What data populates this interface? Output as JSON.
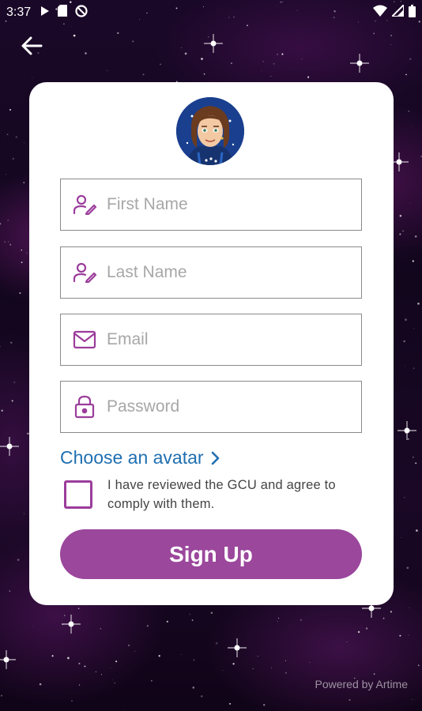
{
  "status_bar": {
    "time": "3:37",
    "icons_left": [
      "play-icon",
      "sd-card-icon",
      "do-not-disturb-icon"
    ],
    "icons_right": [
      "wifi-icon",
      "signal-icon",
      "battery-icon"
    ]
  },
  "header": {
    "back_icon": "arrow-left-icon"
  },
  "form": {
    "fields": [
      {
        "name": "first-name",
        "placeholder": "First Name",
        "value": "",
        "icon": "user-edit-icon"
      },
      {
        "name": "last-name",
        "placeholder": "Last Name",
        "value": "",
        "icon": "user-edit-icon"
      },
      {
        "name": "email",
        "placeholder": "Email",
        "value": "",
        "icon": "envelope-icon"
      },
      {
        "name": "password",
        "placeholder": "Password",
        "value": "",
        "icon": "lock-icon"
      }
    ],
    "choose_avatar_label": "Choose an avatar",
    "agree_text": "I have reviewed the GCU and agree to comply with them.",
    "agree_checked": false,
    "signup_label": "Sign Up"
  },
  "footer": {
    "powered_by": "Powered by Artime"
  },
  "colors": {
    "accent": "#9b479c",
    "link": "#1f6fb0",
    "card": "#ffffff",
    "field_border": "#8a8a8a"
  }
}
